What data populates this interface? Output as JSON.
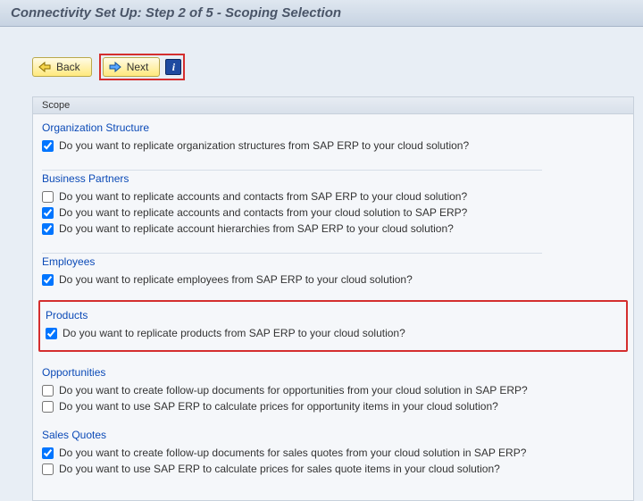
{
  "title": "Connectivity Set Up: Step 2 of 5 - Scoping Selection",
  "buttons": {
    "back": "Back",
    "next": "Next",
    "info": "i"
  },
  "scope_label": "Scope",
  "groups": [
    {
      "key": "organization-structure",
      "title": "Organization Structure",
      "questions": [
        {
          "checked": true,
          "text": "Do you want to replicate organization structures from SAP ERP to your cloud solution?"
        }
      ]
    },
    {
      "key": "business-partners",
      "title": "Business Partners",
      "questions": [
        {
          "checked": false,
          "text": "Do you want to replicate accounts and contacts from SAP ERP to your cloud solution?"
        },
        {
          "checked": true,
          "text": "Do you want to replicate accounts and contacts from your cloud solution to SAP ERP?"
        },
        {
          "checked": true,
          "text": "Do you want to replicate account hierarchies from SAP ERP to your cloud solution?"
        }
      ]
    },
    {
      "key": "employees",
      "title": "Employees",
      "questions": [
        {
          "checked": true,
          "text": "Do you want to replicate employees from SAP ERP to your cloud solution?"
        }
      ]
    },
    {
      "key": "products",
      "title": "Products",
      "highlight": true,
      "questions": [
        {
          "checked": true,
          "text": "Do you want to replicate products from SAP ERP to your cloud solution?"
        }
      ]
    },
    {
      "key": "opportunities",
      "title": "Opportunities",
      "questions": [
        {
          "checked": false,
          "text": "Do you want to create follow-up documents for opportunities from your cloud solution in SAP ERP?"
        },
        {
          "checked": false,
          "text": "Do you want to use SAP ERP to calculate prices for opportunity items in your cloud solution?"
        }
      ]
    },
    {
      "key": "sales-quotes",
      "title": "Sales Quotes",
      "questions": [
        {
          "checked": true,
          "text": "Do you want to create follow-up documents for sales quotes from your cloud solution in SAP ERP?"
        },
        {
          "checked": false,
          "text": "Do you want to use SAP ERP to calculate prices for sales quote items in your cloud solution?"
        }
      ]
    }
  ]
}
